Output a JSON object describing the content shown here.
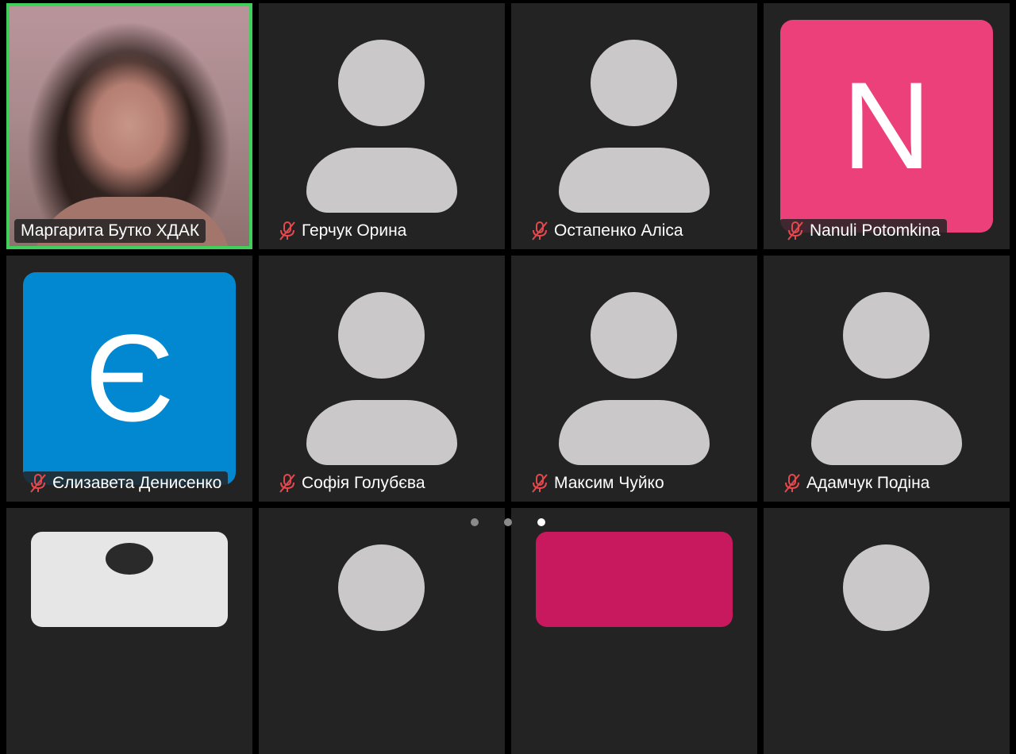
{
  "participants": [
    {
      "name": "Маргарита Бутко ХДАК",
      "muted": false,
      "type": "video",
      "active": true
    },
    {
      "name": "Герчук Орина",
      "muted": true,
      "type": "generic"
    },
    {
      "name": "Остапенко Аліса",
      "muted": true,
      "type": "generic"
    },
    {
      "name": "Nanuli Potomkina",
      "muted": true,
      "type": "letter",
      "letter": "N",
      "color": "#ec407a"
    },
    {
      "name": "Єлизавета Денисенко",
      "muted": true,
      "type": "letter",
      "letter": "Є",
      "color": "#0288d1"
    },
    {
      "name": "Софія Голубєва",
      "muted": true,
      "type": "generic"
    },
    {
      "name": "Максим Чуйко",
      "muted": true,
      "type": "generic"
    },
    {
      "name": "Адамчук Подіна",
      "muted": true,
      "type": "generic"
    }
  ],
  "pager": {
    "pages": 3,
    "current": 3
  },
  "colors": {
    "active_border": "#3fcf5a",
    "mic_off": "#e5484d",
    "tile_bg": "#232323"
  }
}
